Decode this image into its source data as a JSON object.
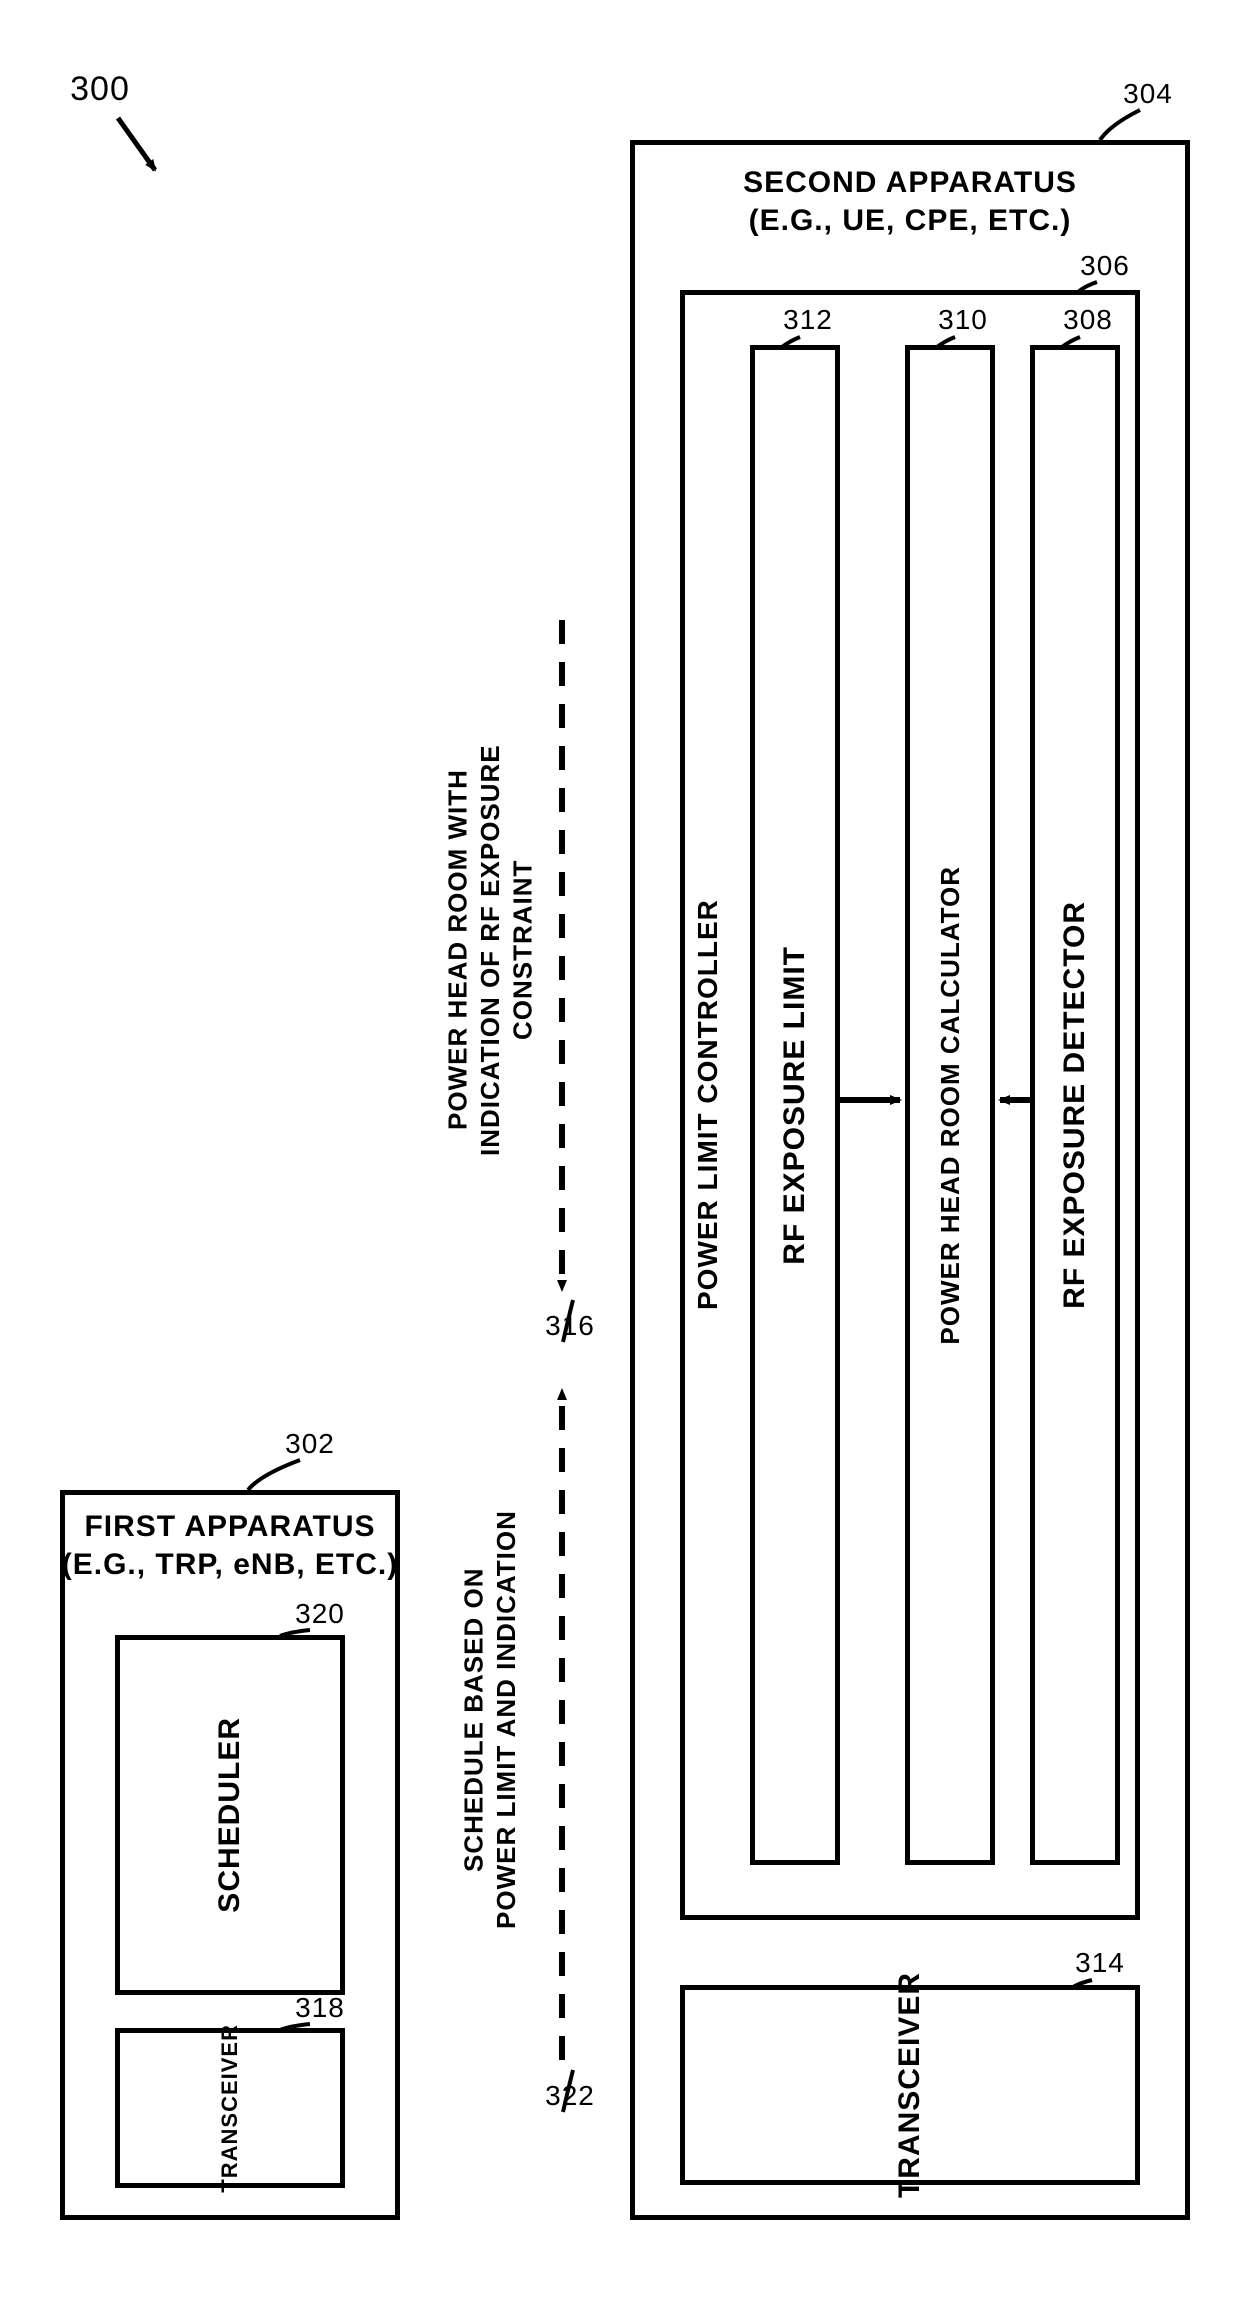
{
  "figure_ref": "300",
  "first": {
    "ref": "302",
    "title_line1": "FIRST APPARATUS",
    "title_line2": "(E.G., TRP, eNB, ETC.)",
    "scheduler": {
      "label": "SCHEDULER",
      "ref": "320"
    },
    "transceiver": {
      "label": "TRANSCEIVER",
      "ref": "318"
    }
  },
  "second": {
    "ref": "304",
    "title_line1": "SECOND APPARATUS",
    "title_line2": "(E.G., UE, CPE, ETC.)",
    "plc": {
      "label": "POWER LIMIT CONTROLLER",
      "ref": "306"
    },
    "rf_limit": {
      "label": "RF EXPOSURE LIMIT",
      "ref": "312"
    },
    "phr_calc": {
      "label": "POWER HEAD ROOM CALCULATOR",
      "ref": "310"
    },
    "rf_det": {
      "label": "RF EXPOSURE DETECTOR",
      "ref": "308"
    },
    "transceiver": {
      "label": "TRANSCEIVER",
      "ref": "314"
    }
  },
  "msg_phr": {
    "line1": "POWER HEAD ROOM WITH",
    "line2": "INDICATION OF RF EXPOSURE",
    "line3": "CONSTRAINT",
    "ref": "316"
  },
  "msg_sched": {
    "line1": "SCHEDULE BASED ON",
    "line2": "POWER LIMIT AND INDICATION",
    "ref": "322"
  },
  "chart_data": {
    "type": "diagram",
    "nodes": [
      {
        "id": "300",
        "label": "300",
        "kind": "figure-ref"
      },
      {
        "id": "302",
        "label": "FIRST APPARATUS (E.G., TRP, eNB, ETC.)"
      },
      {
        "id": "320",
        "label": "SCHEDULER",
        "parent": "302"
      },
      {
        "id": "318",
        "label": "TRANSCEIVER",
        "parent": "302"
      },
      {
        "id": "304",
        "label": "SECOND APPARATUS (E.G., UE, CPE, ETC.)"
      },
      {
        "id": "306",
        "label": "POWER LIMIT CONTROLLER",
        "parent": "304"
      },
      {
        "id": "312",
        "label": "RF EXPOSURE LIMIT",
        "parent": "306"
      },
      {
        "id": "310",
        "label": "POWER HEAD ROOM CALCULATOR",
        "parent": "306"
      },
      {
        "id": "308",
        "label": "RF EXPOSURE DETECTOR",
        "parent": "306"
      },
      {
        "id": "314",
        "label": "TRANSCEIVER",
        "parent": "304"
      }
    ],
    "edges": [
      {
        "from": "312",
        "to": "310",
        "style": "solid-arrow"
      },
      {
        "from": "308",
        "to": "310",
        "style": "solid-arrow"
      },
      {
        "from": "304",
        "to": "302",
        "label": "POWER HEAD ROOM WITH INDICATION OF RF EXPOSURE CONSTRAINT",
        "id": "316",
        "style": "dashed-arrow"
      },
      {
        "from": "302",
        "to": "304",
        "label": "SCHEDULE BASED ON POWER LIMIT AND INDICATION",
        "id": "322",
        "style": "dashed-arrow"
      }
    ]
  }
}
